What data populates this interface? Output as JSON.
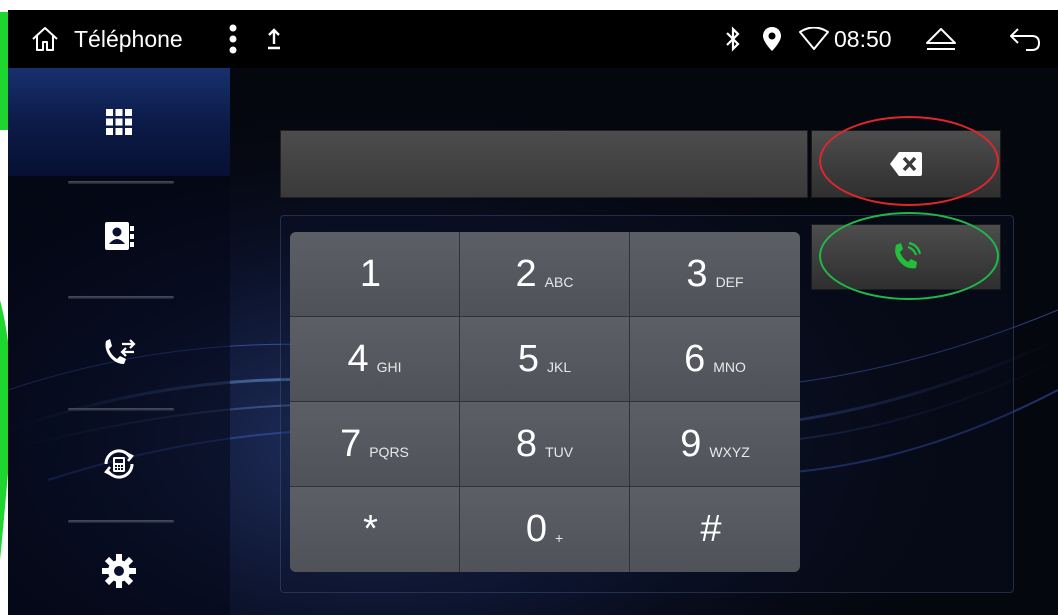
{
  "status_bar": {
    "app_title": "Téléphone",
    "time": "08:50",
    "icons": {
      "home": "home-icon",
      "menu": "more-vertical-icon",
      "upload": "upload-icon",
      "bluetooth": "bluetooth-icon",
      "location": "location-pin-icon",
      "wifi": "wifi-signal-icon",
      "eject": "eject-icon",
      "back": "back-arrow-icon"
    }
  },
  "sidebar": {
    "items": [
      {
        "icon": "dialpad-icon",
        "active": true
      },
      {
        "icon": "contacts-icon",
        "active": false
      },
      {
        "icon": "call-log-icon",
        "active": false
      },
      {
        "icon": "phone-sync-icon",
        "active": false
      },
      {
        "icon": "settings-gear-icon",
        "active": false
      }
    ]
  },
  "dialer": {
    "number_value": "",
    "backspace_icon": "backspace-icon",
    "call_icon": "phone-call-icon",
    "keys": [
      {
        "digit": "1",
        "letters": ""
      },
      {
        "digit": "2",
        "letters": "ABC"
      },
      {
        "digit": "3",
        "letters": "DEF"
      },
      {
        "digit": "4",
        "letters": "GHI"
      },
      {
        "digit": "5",
        "letters": "JKL"
      },
      {
        "digit": "6",
        "letters": "MNO"
      },
      {
        "digit": "7",
        "letters": "PQRS"
      },
      {
        "digit": "8",
        "letters": "TUV"
      },
      {
        "digit": "9",
        "letters": "WXYZ"
      },
      {
        "digit": "*",
        "letters": ""
      },
      {
        "digit": "0",
        "letters": "+"
      },
      {
        "digit": "#",
        "letters": ""
      }
    ]
  },
  "annotations": {
    "backspace_highlight_color": "#e0262a",
    "call_highlight_color": "#1fb84a"
  },
  "colors": {
    "call_green": "#22c03a",
    "deco_green": "#1fd630",
    "screen_bg": "#05070f"
  }
}
